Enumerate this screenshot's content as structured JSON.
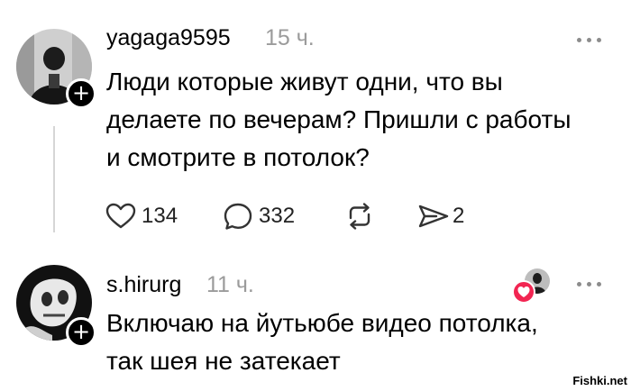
{
  "posts": [
    {
      "username": "yagaga9595",
      "time": "15 ч.",
      "text": "Люди которые живут одни, что вы\nделаете по вечерам? Пришли с работы\nи смотрите в потолок?",
      "actions": {
        "likes": "134",
        "replies": "332",
        "shares": "2"
      }
    },
    {
      "username": "s.hirurg",
      "time": "11 ч.",
      "text": "Включаю на йутьюбе видео потолка,\nтак шея не затекает"
    }
  ],
  "icons": {
    "follow": "plus-icon",
    "more": "more-dots-icon",
    "like": "heart-icon",
    "reply": "comment-bubble-icon",
    "repost": "repost-icon",
    "share": "send-icon",
    "liked_by_author": "heart-icon"
  },
  "colors": {
    "text": "#000000",
    "muted": "#9b9b9b",
    "thread_line": "#d6d6d6",
    "like_badge": "#f22552"
  },
  "watermark": "Fishki.net"
}
